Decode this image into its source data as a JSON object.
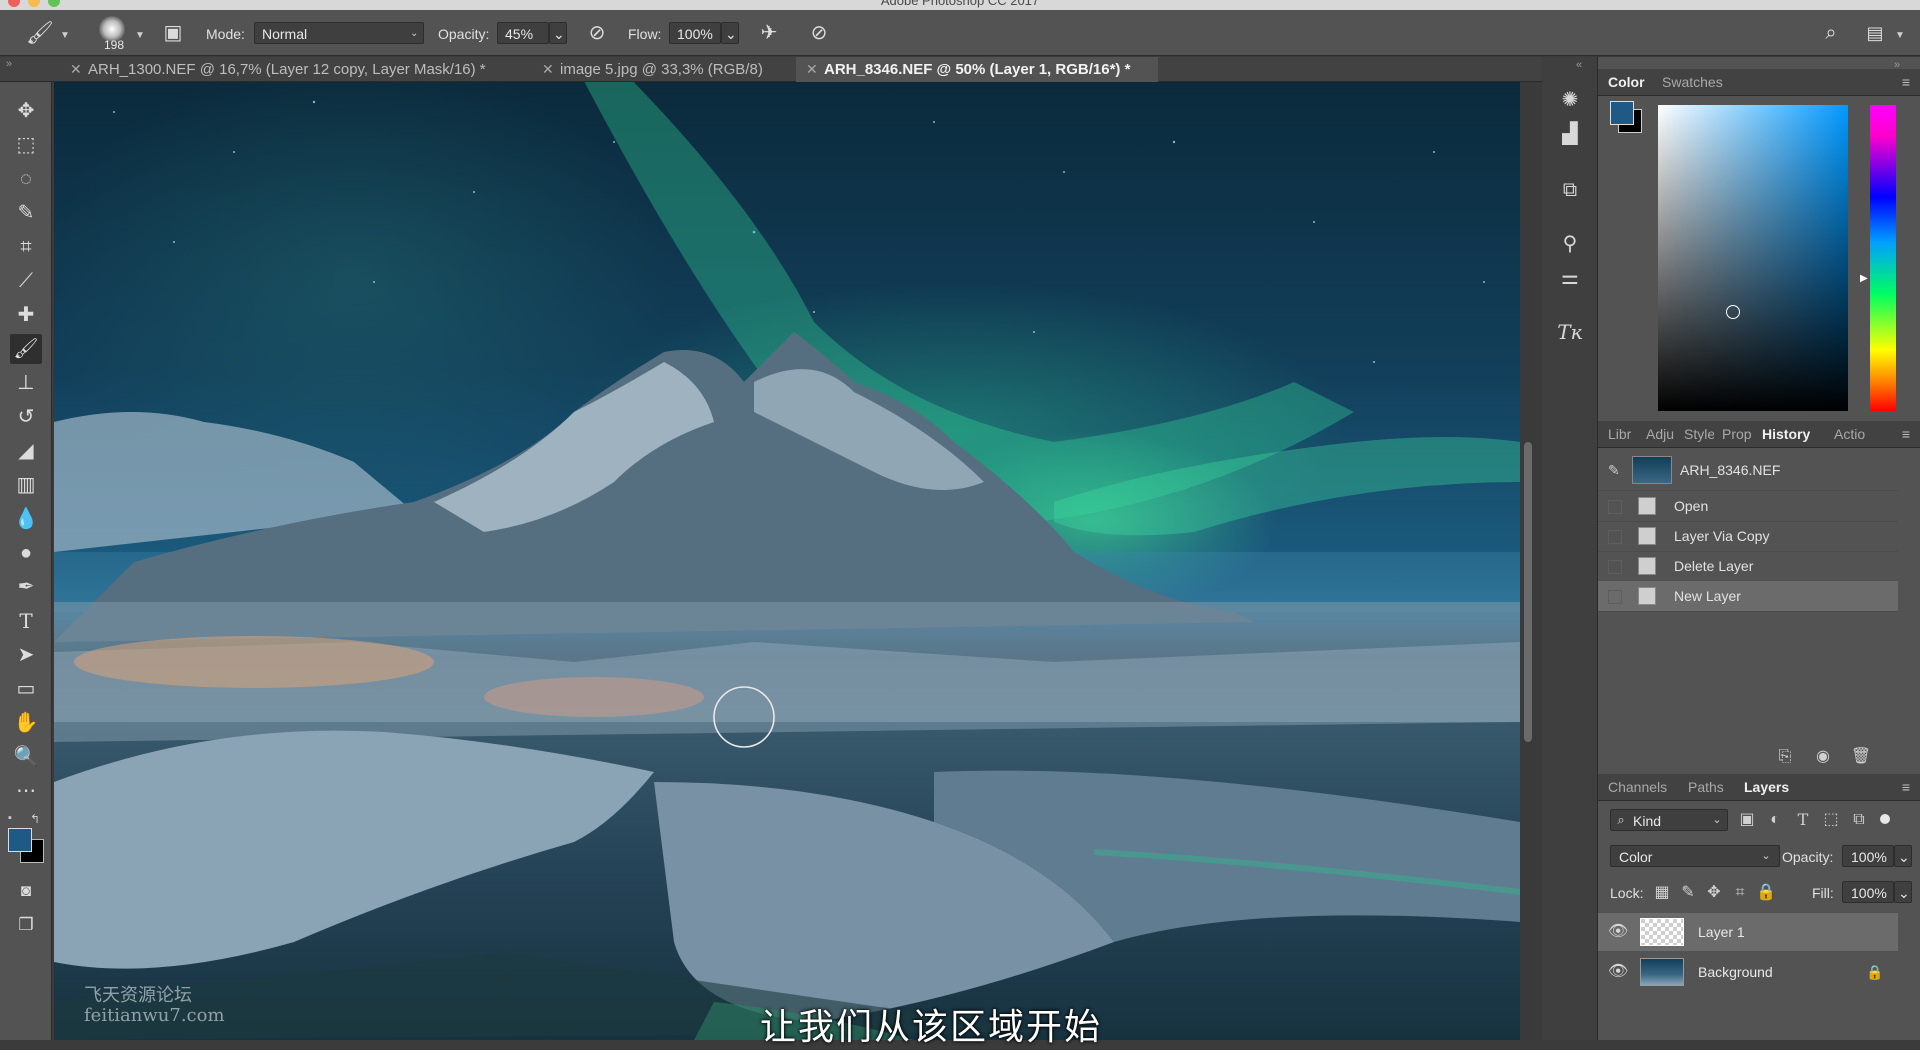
{
  "app": {
    "title": "Adobe Photoshop CC 2017"
  },
  "options_bar": {
    "brush_size": "198",
    "mode_label": "Mode:",
    "mode_value": "Normal",
    "opacity_label": "Opacity:",
    "opacity_value": "45%",
    "flow_label": "Flow:",
    "flow_value": "100%"
  },
  "tabs": [
    {
      "label": "ARH_1300.NEF @ 16,7% (Layer 12 copy, Layer Mask/16) *",
      "active": false
    },
    {
      "label": "image 5.jpg @ 33,3% (RGB/8)",
      "active": false
    },
    {
      "label": "ARH_8346.NEF @ 50% (Layer 1, RGB/16*) *",
      "active": true
    }
  ],
  "color_panel": {
    "tabs": [
      "Color",
      "Swatches"
    ],
    "active_tab": "Color",
    "foreground": "#1f5a86",
    "background": "#000000"
  },
  "history_panel": {
    "tabs": [
      "Libr",
      "Adju",
      "Style",
      "Prop",
      "History",
      "Actio"
    ],
    "active_tab": "History",
    "snapshot": "ARH_8346.NEF",
    "steps": [
      "Open",
      "Layer Via Copy",
      "Delete Layer",
      "New Layer"
    ],
    "selected_step": "New Layer"
  },
  "layers_panel": {
    "tabs": [
      "Channels",
      "Paths",
      "Layers"
    ],
    "active_tab": "Layers",
    "filter_kind": "Kind",
    "blend_mode": "Color",
    "opacity_label": "Opacity:",
    "opacity_value": "100%",
    "lock_label": "Lock:",
    "fill_label": "Fill:",
    "fill_value": "100%",
    "layers": [
      {
        "name": "Layer 1",
        "selected": true,
        "visible": true,
        "locked": false
      },
      {
        "name": "Background",
        "selected": false,
        "visible": true,
        "locked": true
      }
    ]
  },
  "watermark": {
    "line1": "飞天资源论坛",
    "line2": "feitianwu7.com"
  },
  "subtitle": "让我们从该区域开始",
  "icons": {
    "tools": [
      "move-icon",
      "marquee-icon",
      "lasso-icon",
      "quick-selection-icon",
      "crop-icon",
      "eyedropper-icon",
      "healing-brush-icon",
      "brush-icon",
      "clone-stamp-icon",
      "history-brush-icon",
      "eraser-icon",
      "gradient-icon",
      "blur-icon",
      "dodge-icon",
      "pen-icon",
      "type-icon",
      "path-selection-icon",
      "rectangle-icon",
      "hand-icon",
      "zoom-icon",
      "more-tools-icon"
    ]
  }
}
